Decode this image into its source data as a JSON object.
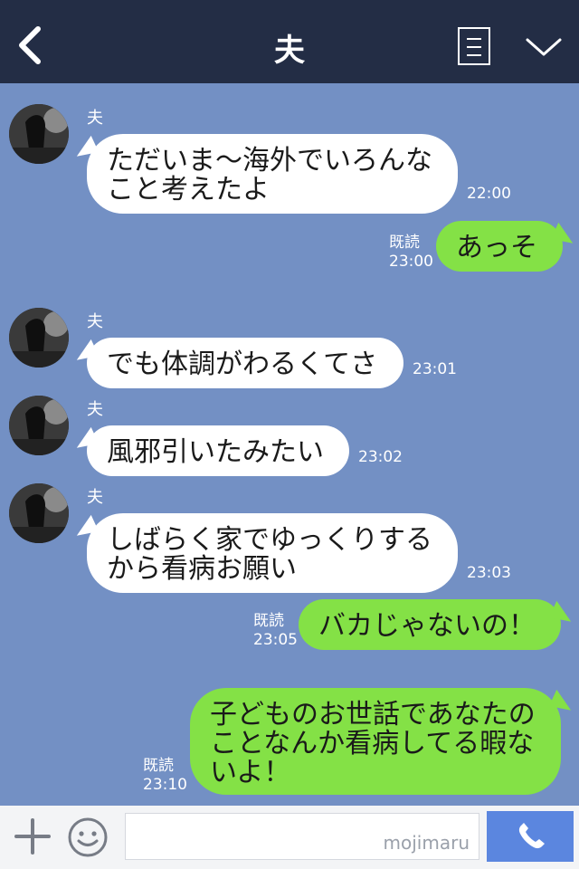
{
  "header": {
    "back_icon": "chevron-left-icon",
    "title": "夫",
    "menu_icon": "list-icon",
    "collapse_icon": "chevron-down-icon"
  },
  "messages": [
    {
      "side": "in",
      "sender": "夫",
      "text": "ただいま〜海外でいろんなこと考えたよ",
      "time": "22:00"
    },
    {
      "side": "out",
      "read": "既読",
      "text": "あっそ",
      "time": "23:00"
    },
    {
      "side": "in",
      "sender": "夫",
      "text": "でも体調がわるくてさ",
      "time": "23:01"
    },
    {
      "side": "in",
      "sender": "夫",
      "text": "風邪引いたみたい",
      "time": "23:02"
    },
    {
      "side": "in",
      "sender": "夫",
      "text": "しばらく家でゆっくりするから看病お願い",
      "time": "23:03"
    },
    {
      "side": "out",
      "read": "既読",
      "text": "バカじゃないの！",
      "time": "23:05"
    },
    {
      "side": "out",
      "read": "既読",
      "text": "子どものお世話であなたのことなんか看病してる暇ないよ！",
      "time": "23:10"
    }
  ],
  "footer": {
    "plus_icon": "plus-icon",
    "emoji_icon": "smiley-icon",
    "input_value": "",
    "watermark": "mojimaru",
    "send_icon": "phone-icon"
  },
  "colors": {
    "header_bg": "#232d45",
    "chat_bg": "#7390c4",
    "incoming_bubble": "#ffffff",
    "outgoing_bubble": "#84e146",
    "send_button": "#5b86df"
  }
}
